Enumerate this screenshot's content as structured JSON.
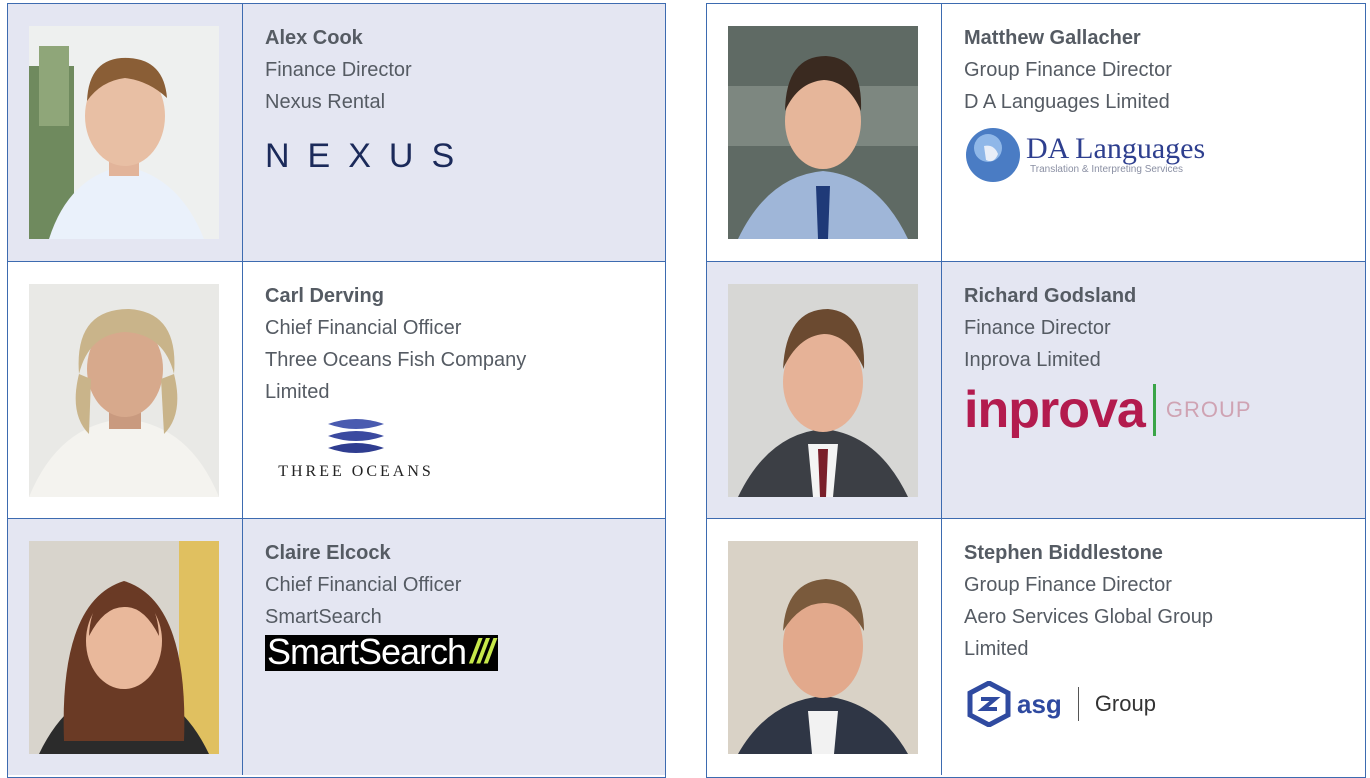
{
  "people": [
    {
      "name": "Alex Cook",
      "title": "Finance Director",
      "company": [
        "Nexus Rental"
      ],
      "logo_text": "NEXUS",
      "photo_icon": "person-photo"
    },
    {
      "name": "Carl Derving",
      "title": "Chief Financial Officer",
      "company": [
        "Three Oceans Fish Company",
        "Limited"
      ],
      "logo_text": "THREE OCEANS",
      "photo_icon": "person-photo"
    },
    {
      "name": "Claire Elcock",
      "title": "Chief Financial Officer",
      "company": [
        "SmartSearch"
      ],
      "logo_text": "SmartSearch",
      "logo_slashes": "///",
      "photo_icon": "person-photo"
    },
    {
      "name": "Matthew Gallacher",
      "title": "Group Finance Director",
      "company": [
        "D A Languages Limited"
      ],
      "logo_text": "DA Languages",
      "logo_subtext": "Translation & Interpreting Services",
      "photo_icon": "person-photo"
    },
    {
      "name": "Richard Godsland",
      "title": "Finance Director",
      "company": [
        "Inprova Limited"
      ],
      "logo_text": "inprova",
      "logo_subtext": "GROUP",
      "photo_icon": "person-photo"
    },
    {
      "name": "Stephen Biddlestone",
      "title": "Group Finance Director",
      "company": [
        "Aero Services Global Group",
        "Limited"
      ],
      "logo_text": "asg",
      "logo_subtext": "Group",
      "photo_icon": "person-photo"
    }
  ],
  "colors": {
    "border": "#3d6bb0",
    "shade": "#e4e6f2",
    "text": "#555b63"
  }
}
